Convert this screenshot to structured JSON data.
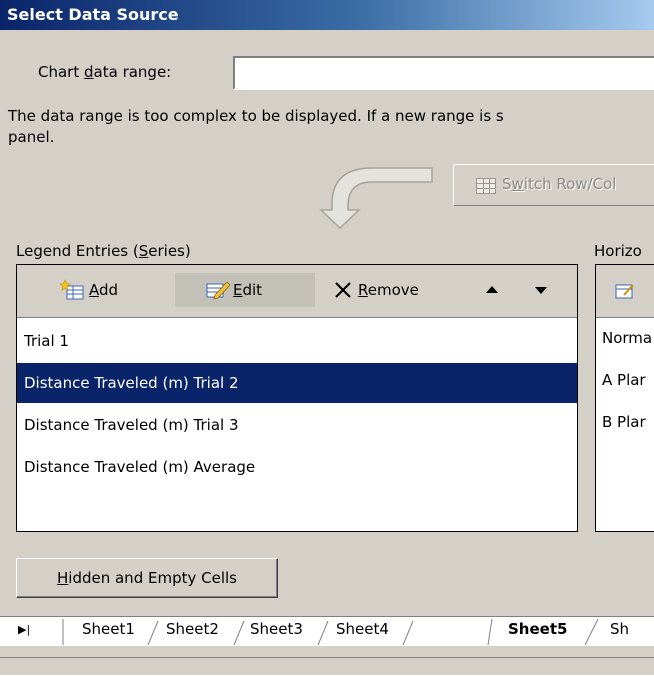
{
  "dialog": {
    "title": "Select Data Source"
  },
  "range": {
    "label_pre": "Chart ",
    "label_key": "d",
    "label_post": "ata range:",
    "value": ""
  },
  "message": {
    "line1": "The data range is too complex to be displayed. If a new range is s",
    "line2": "panel."
  },
  "switch_button": {
    "label_pre": "S",
    "label_key": "w",
    "label_post": "itch Row/Col"
  },
  "legend": {
    "label_pre": "Legend Entries (",
    "label_key": "S",
    "label_post": "eries)",
    "toolbar": {
      "add_key": "A",
      "add_post": "dd",
      "edit_key": "E",
      "edit_post": "dit",
      "remove_key": "R",
      "remove_post": "emove"
    },
    "items": [
      {
        "label": "Trial 1",
        "selected": false
      },
      {
        "label": "Distance Traveled (m) Trial 2",
        "selected": true
      },
      {
        "label": "Distance Traveled (m) Trial 3",
        "selected": false
      },
      {
        "label": "Distance Traveled (m) Average",
        "selected": false
      }
    ]
  },
  "horizontal": {
    "label": "Horizo",
    "items": [
      "Norma",
      "A Plar",
      "B Plar"
    ]
  },
  "hidden_button": {
    "label_key": "H",
    "label_post": "idden and Empty Cells"
  },
  "sheet_tabs": [
    "Sheet1",
    "Sheet2",
    "Sheet3",
    "Sheet4",
    "Sheet5",
    "Sh"
  ],
  "active_sheet": "Sheet5",
  "colors": {
    "selection": "#0a246a",
    "dialog_bg": "#d4d0c8"
  }
}
